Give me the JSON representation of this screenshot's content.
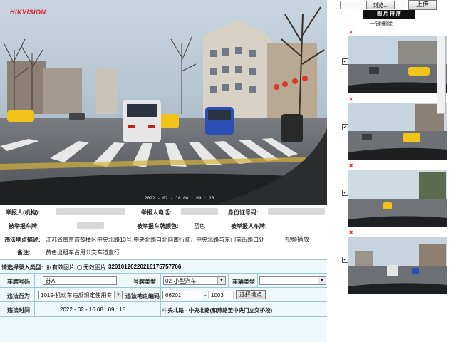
{
  "photo": {
    "brand": "HIKVISION",
    "timestamp": "2022 - 02 - 16  08 : 09 : 23"
  },
  "info": {
    "reporter_label": "举报人(机构):",
    "reporter_phone_label": "举报人电话:",
    "id_label": "身份证号码:",
    "reported_plate_label": "被举报车牌:",
    "reported_plate_color_label": "被举报车牌颜色:",
    "reported_plate_color": "蓝色",
    "reported_owner_label": "被举报人车牌:",
    "location_desc_label": "违法地点描述:",
    "location_desc": "江苏省南京市鼓楼区中央北路13号,中央北路自北向南行驶，中央北路与东门前街路口处",
    "video_link": "视频播放",
    "remark_label": "备注:",
    "remark": "黄色出租车占用公交车道直行"
  },
  "form": {
    "entry_type_label": "请选择录入类型:",
    "option_valid": "有效图片",
    "option_invalid": "无效图片",
    "record_id": "32010120220216175757766",
    "plate_no_label": "车牌号码",
    "plate_no_value": "苏A",
    "plate_type_label": "号牌类型",
    "plate_type_value": "02-小型汽车",
    "vehicle_type_label": "车辆类型",
    "vehicle_type_value": "",
    "violation_label": "违法行为",
    "violation_value": "1019-机动车违反规定使用专",
    "location_code_label": "违法地点编码",
    "location_code_1": "66201",
    "location_code_sep": "-",
    "location_code_2": "1003",
    "choose_location_button": "选择地点",
    "time_label": "违法时间",
    "time_value": "2022 - 02 - 16   08 : 09 : 15",
    "location_text": "中央北路 - 中央北路(和燕路至中央门立交桥段)"
  },
  "right_panel": {
    "browse_button": "浏览...",
    "upload_button": "上传",
    "sort_button": "图 片 排 序",
    "delete_all_link": "一键删除",
    "thumbnails": [
      {
        "checked": "✓",
        "remove": "×"
      },
      {
        "checked": "✓",
        "remove": "×"
      },
      {
        "checked": "✓",
        "remove": "×"
      },
      {
        "checked": "✓",
        "remove": "×"
      }
    ]
  },
  "colors": {
    "brand_red": "#e0202a",
    "form_bg": "#eef8fb",
    "border_blue": "#9cc7d4",
    "taxi_yellow": "#f2c318",
    "bus_blue": "#2a4fb5"
  }
}
